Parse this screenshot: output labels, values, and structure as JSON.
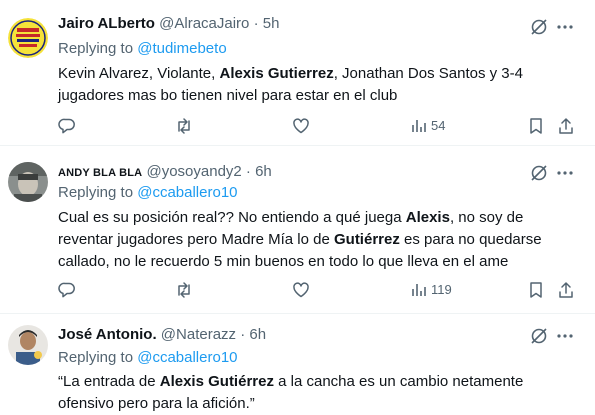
{
  "tweets": [
    {
      "name": "Jairo ALberto",
      "handle": "@AlracaJairo",
      "sep": "·",
      "time": "5h",
      "reply_prefix": "Replying to",
      "reply_to": "@tudimebeto",
      "body": [
        {
          "t": "Kevin Alvarez, Violante, ",
          "b": false
        },
        {
          "t": "Alexis Gutierrez",
          "b": true
        },
        {
          "t": ", Jonathan Dos Santos  y 3-4 jugadores mas bo tienen nivel para estar en el club",
          "b": false
        }
      ],
      "views": "54"
    },
    {
      "name": "ANDY BLA BLA",
      "handle": "@yosoyandy2",
      "sep": "·",
      "time": "6h",
      "reply_prefix": "Replying to",
      "reply_to": "@ccaballero10",
      "body": [
        {
          "t": "Cual es su posición real?? No entiendo a qué juega ",
          "b": false
        },
        {
          "t": "Alexis",
          "b": true
        },
        {
          "t": ", no soy de reventar jugadores pero Madre Mía lo de ",
          "b": false
        },
        {
          "t": "Gutiérrez",
          "b": true
        },
        {
          "t": " es para no quedarse callado, no le recuerdo 5 min buenos en todo lo que lleva en el ame",
          "b": false
        }
      ],
      "views": "119"
    },
    {
      "name": "José Antonio.",
      "handle": "@Naterazz",
      "sep": "·",
      "time": "6h",
      "reply_prefix": "Replying to",
      "reply_to": "@ccaballero10",
      "body": [
        {
          "t": "“La entrada de ",
          "b": false
        },
        {
          "t": "Alexis Gutiérrez",
          "b": true
        },
        {
          "t": " a la cancha es un cambio netamente ofensivo pero para la afición.”",
          "b": false
        }
      ],
      "views": ""
    }
  ],
  "icons": {
    "reply": "reply-icon",
    "retweet": "retweet-icon",
    "like": "like-icon",
    "views": "views-icon",
    "bookmark": "bookmark-icon",
    "share": "share-icon",
    "grok": "grok-icon",
    "more": "more-icon"
  },
  "colors": {
    "text": "#0f1419",
    "secondary": "#536471",
    "link": "#1d9bf0",
    "divider": "#eff3f4"
  }
}
